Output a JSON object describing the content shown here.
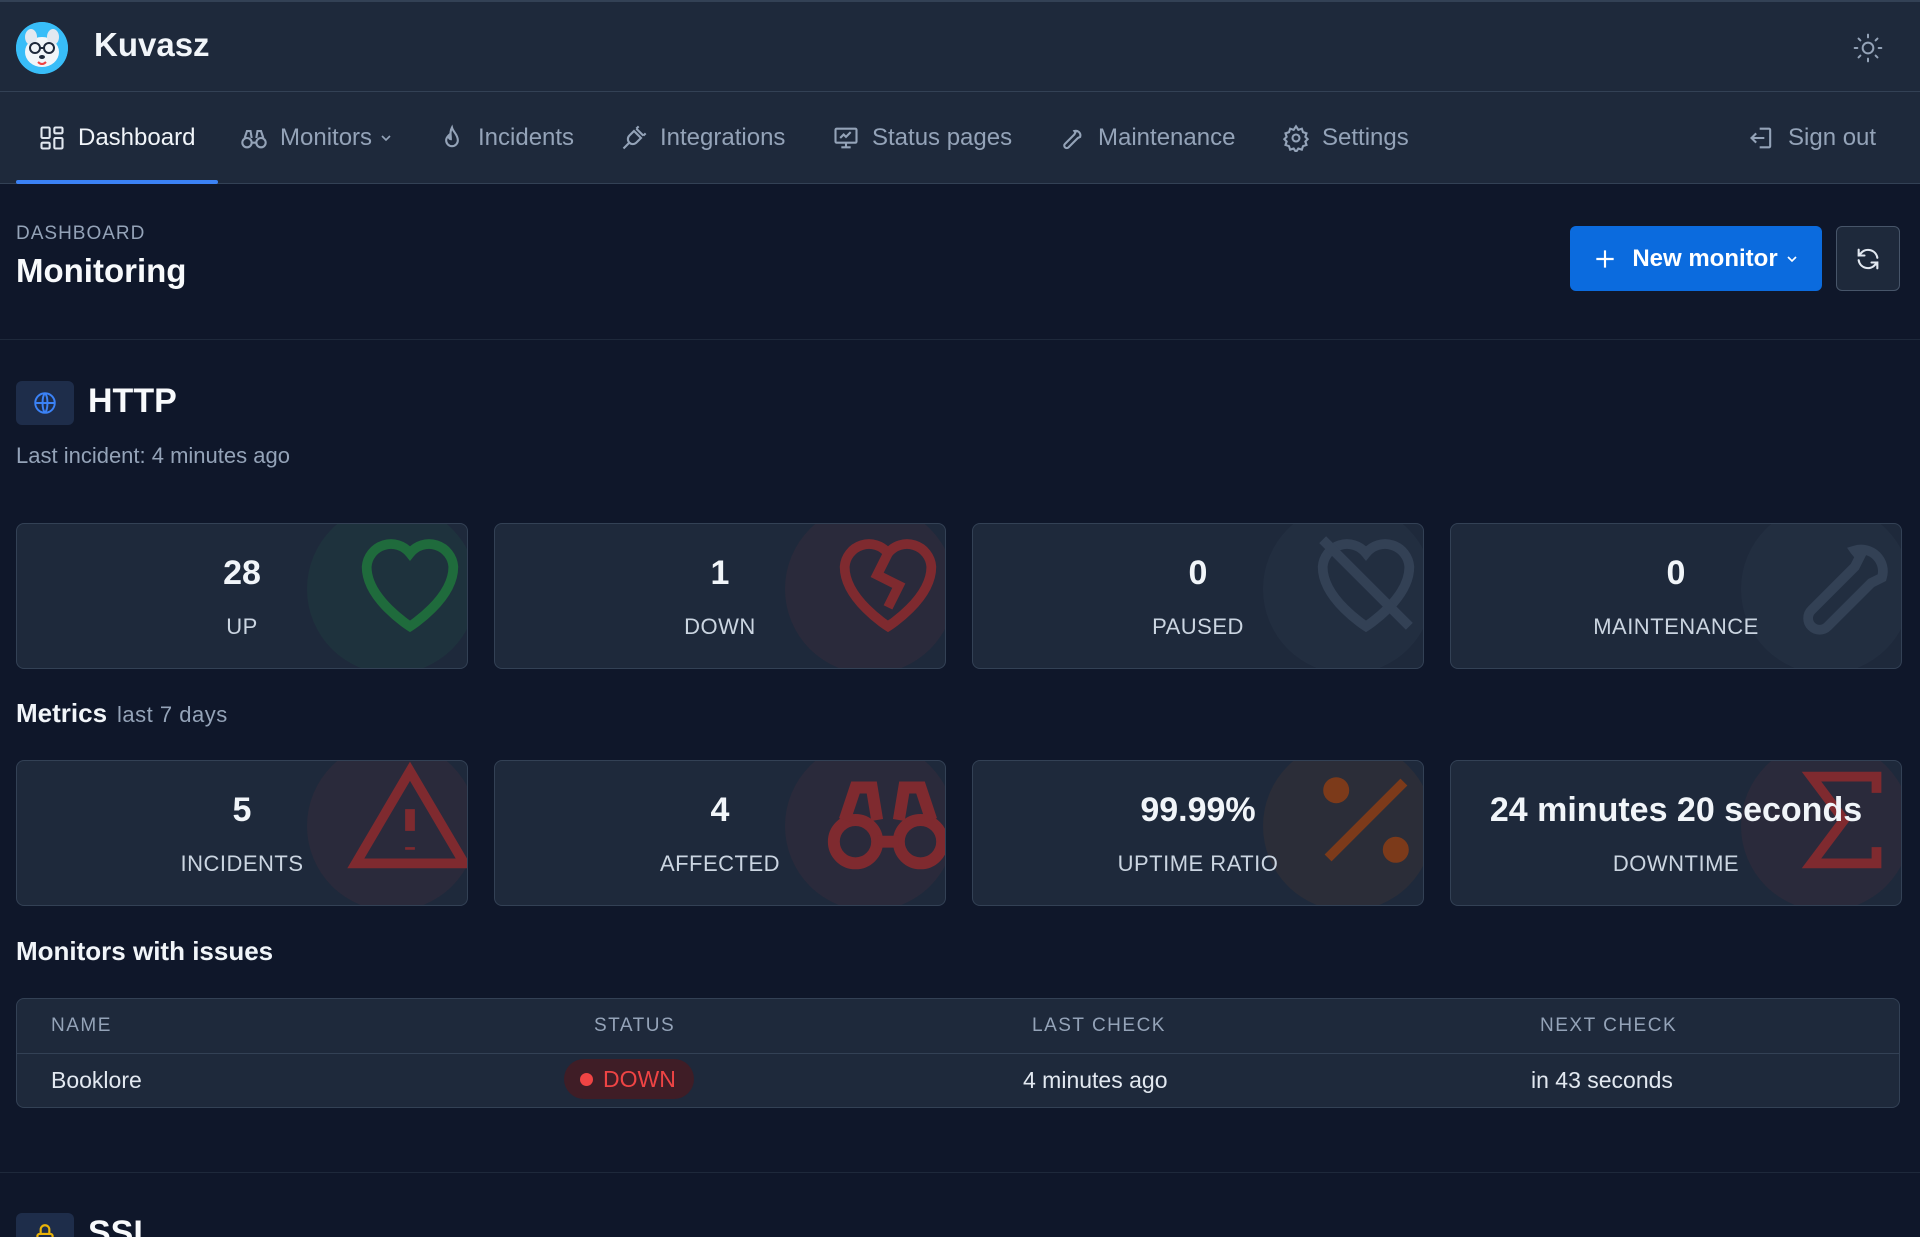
{
  "app": {
    "name": "Kuvasz"
  },
  "nav": {
    "items": [
      {
        "label": "Dashboard",
        "icon": "dashboard-icon"
      },
      {
        "label": "Monitors",
        "icon": "binoculars-icon"
      },
      {
        "label": "Incidents",
        "icon": "flame-icon"
      },
      {
        "label": "Integrations",
        "icon": "plug-icon"
      },
      {
        "label": "Status pages",
        "icon": "presentation-icon"
      },
      {
        "label": "Maintenance",
        "icon": "wrench-icon"
      },
      {
        "label": "Settings",
        "icon": "gear-icon"
      }
    ],
    "sign_out": "Sign out"
  },
  "page": {
    "breadcrumb": "DASHBOARD",
    "title": "Monitoring",
    "new_monitor_label": "New monitor"
  },
  "http": {
    "title": "HTTP",
    "last_incident": "Last incident: 4 minutes ago",
    "stats": [
      {
        "value": "28",
        "label": "UP",
        "icon": "heart-icon",
        "color": "#22c55e"
      },
      {
        "value": "1",
        "label": "DOWN",
        "icon": "heart-crack-icon",
        "color": "#ef4444"
      },
      {
        "value": "0",
        "label": "PAUSED",
        "icon": "heart-off-icon",
        "color": "#64748b"
      },
      {
        "value": "0",
        "label": "MAINTENANCE",
        "icon": "wrench-icon",
        "color": "#64748b"
      }
    ],
    "metrics_title": "Metrics",
    "metrics_period": "last 7 days",
    "metrics": [
      {
        "value": "5",
        "label": "INCIDENTS",
        "icon": "warning-icon",
        "color": "#ef4444"
      },
      {
        "value": "4",
        "label": "AFFECTED",
        "icon": "binoculars-icon",
        "color": "#ef4444"
      },
      {
        "value": "99.99%",
        "label": "UPTIME RATIO",
        "icon": "percent-icon",
        "color": "#f97316"
      },
      {
        "value": "24 minutes 20 seconds",
        "label": "DOWNTIME",
        "icon": "sigma-icon",
        "color": "#ef4444"
      }
    ],
    "issues_title": "Monitors with issues",
    "table": {
      "columns": [
        "NAME",
        "STATUS",
        "LAST CHECK",
        "NEXT CHECK"
      ],
      "rows": [
        {
          "name": "Booklore",
          "status": "DOWN",
          "last_check": "4 minutes ago",
          "next_check": "in 43 seconds"
        }
      ]
    }
  },
  "ssl": {
    "title": "SSL"
  },
  "colors": {
    "accent": "#0b6bde",
    "down": "#ef4444",
    "up": "#22c55e",
    "warning": "#eab308"
  }
}
